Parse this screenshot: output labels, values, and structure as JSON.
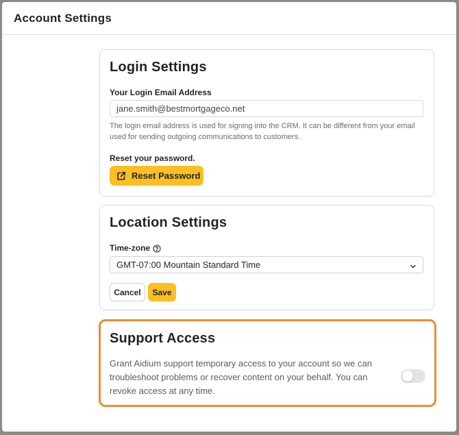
{
  "header": {
    "title": "Account Settings"
  },
  "login": {
    "title": "Login Settings",
    "email_label": "Your Login Email Address",
    "email_value": "jane.smith@bestmortgageco.net",
    "email_help": "The login email address is used for signing into the CRM. It can be different from your email used for sending outgoing communications to customers.",
    "reset_label": "Reset your password.",
    "reset_button": "Reset Password",
    "reset_icon": "external-link-icon"
  },
  "location": {
    "title": "Location Settings",
    "timezone_label": "Time-zone",
    "timezone_help_icon": "question-circle-icon",
    "timezone_value": "GMT-07:00 Mountain Standard Time",
    "cancel_label": "Cancel",
    "save_label": "Save"
  },
  "support": {
    "title": "Support Access",
    "description": "Grant Aidium support temporary access to your account so we can troubleshoot problems or recover content on your behalf. You can revoke access at any time.",
    "access_enabled": false
  },
  "colors": {
    "accent": "#fbbf24",
    "highlight_border": "#f08a2c",
    "border": "#d6d6d6"
  }
}
